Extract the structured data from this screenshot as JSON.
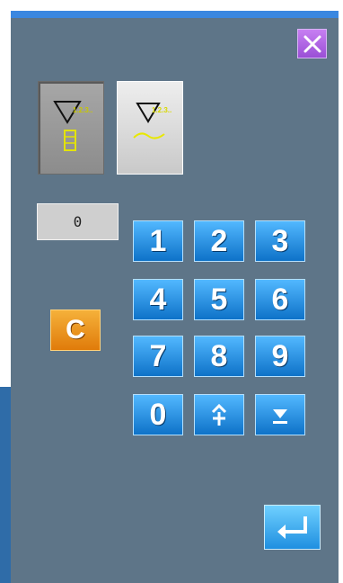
{
  "window": {
    "close_icon": "close-icon"
  },
  "modes": [
    {
      "name": "stitch-pattern-mode",
      "label": "1.2.3..",
      "selected": true,
      "icon": "stitch-pattern-icon"
    },
    {
      "name": "wave-pattern-mode",
      "label": "1.2.3..",
      "selected": false,
      "icon": "wave-icon"
    }
  ],
  "display": {
    "value": "0"
  },
  "keypad": {
    "clear_label": "C",
    "keys": [
      "1",
      "2",
      "3",
      "4",
      "5",
      "6",
      "7",
      "8",
      "9",
      "0"
    ],
    "plus_icon": "plus-arrow-icon",
    "down_icon": "down-arrow-icon"
  },
  "enter": {
    "icon": "enter-icon"
  },
  "colors": {
    "screen_bg": "#5e7588",
    "key_blue": "#1c86dc",
    "clear_orange": "#e88a15",
    "close_purple": "#a85de0",
    "accent_yellow": "#f0e000"
  }
}
